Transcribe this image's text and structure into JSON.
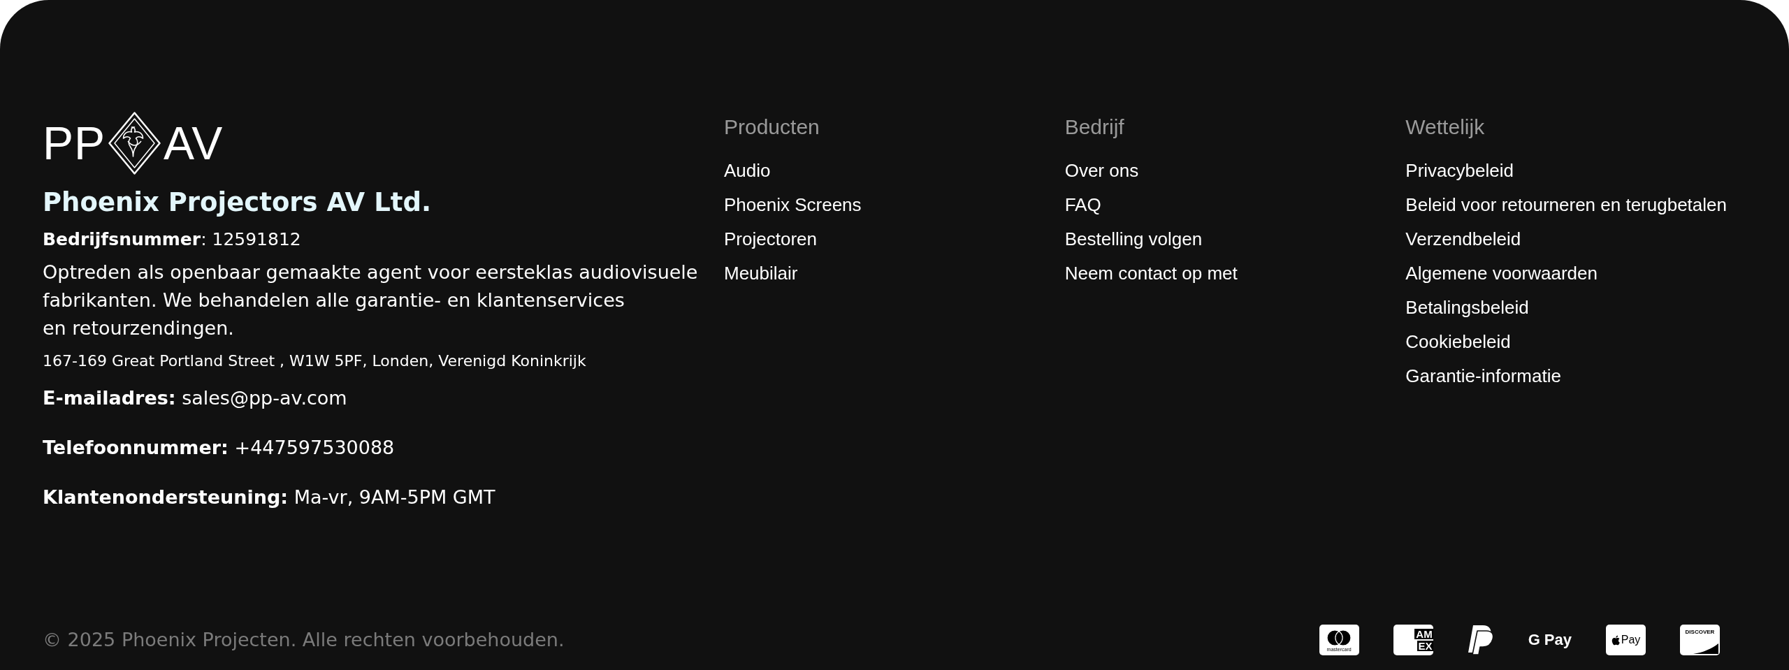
{
  "logo": {
    "left": "PP",
    "right": "AV"
  },
  "company": {
    "name": "Phoenix Projectors AV Ltd.",
    "registration": "**Bedrijfsnummer**: 12591812",
    "description": "Optreden als openbaar gemaakte agent voor eersteklas audiovisuele\nfabrikanten. We behandelen alle garantie- en klantenservices\nen retourzendingen.",
    "address": "167-169 Great Portland Street , W1W 5PF, Londen, Verenigd Koninkrijk",
    "contacts": [
      "**E-mailadres:** sales@pp-av.com",
      "**Telefoonnummer:** +447597530088",
      "**Klantenondersteuning:** Ma-vr, 9AM-5PM GMT"
    ]
  },
  "columns": [
    {
      "heading": "Producten",
      "links": [
        "Audio",
        "Phoenix Screens",
        "Projectoren",
        "Meubilair"
      ]
    },
    {
      "heading": "Bedrijf",
      "links": [
        "Over ons",
        "FAQ",
        "Bestelling volgen",
        "Neem contact op met"
      ]
    },
    {
      "heading": "Wettelijk",
      "links": [
        "Privacybeleid",
        "Beleid voor retourneren en terugbetalen",
        "Verzendbeleid",
        "Algemene voorwaarden",
        "Betalingsbeleid",
        "Cookiebeleid",
        "Garantie-informatie"
      ]
    }
  ],
  "copyright": "© 2025 Phoenix Projecten. Alle rechten voorbehouden.",
  "payment_methods": [
    {
      "kind": "mastercard",
      "label": "mastercard"
    },
    {
      "kind": "amex",
      "lines": [
        "AM",
        "EX"
      ]
    },
    {
      "kind": "paypal"
    },
    {
      "kind": "gpay",
      "label": "G Pay"
    },
    {
      "kind": "applepay",
      "label": "Pay"
    },
    {
      "kind": "discover",
      "label": "DISCOVER"
    }
  ]
}
